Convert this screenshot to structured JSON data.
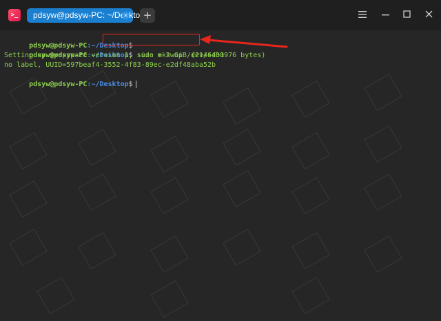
{
  "window": {
    "tab_title": "pdsyw@pdsyw-PC: ~/Desktop",
    "new_tab_label": "+",
    "controls": {
      "menu_icon": "hamburger-menu-icon",
      "minimize_icon": "minimize-icon",
      "maximize_icon": "maximize-icon",
      "close_icon": "close-icon"
    }
  },
  "terminal": {
    "lines": [
      {
        "user": "pdsyw@pdsyw-PC",
        "path": ":~/Desktop",
        "sym": "$"
      },
      {
        "user": "pdsyw@pdsyw-PC",
        "path": ":~/Desktop",
        "sym": "$",
        "command": "sudo mkswap /dev/sdb1"
      },
      {
        "output": "Setting up swapspace version 1, size = 2 GiB (2146430976 bytes)"
      },
      {
        "output": "no label, UUID=597beaf4-3552-4f83-89ec-e2df48aba52b"
      },
      {
        "user": "pdsyw@pdsyw-PC",
        "path": ":~/Desktop",
        "sym": "$"
      }
    ]
  },
  "annotation": {
    "highlight_color": "#e8261c"
  }
}
